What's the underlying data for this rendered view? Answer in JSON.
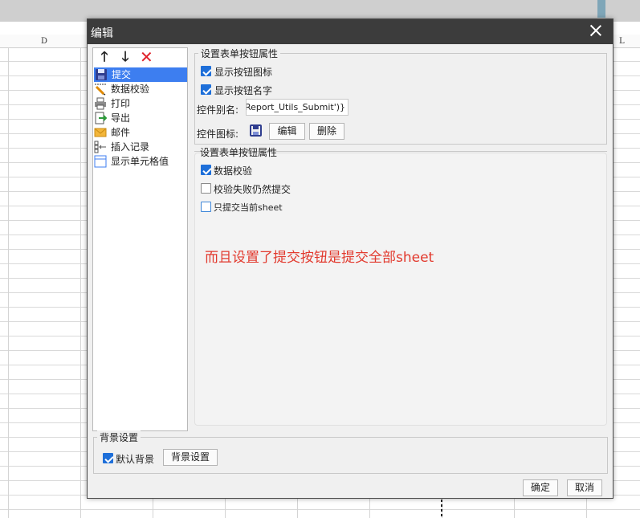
{
  "sheet": {
    "columns": [
      "D",
      "L"
    ]
  },
  "dialog": {
    "title": "编辑",
    "toolbar": {
      "up_icon": "arrow-up-icon",
      "down_icon": "arrow-down-icon",
      "delete_icon": "delete-x-icon"
    },
    "list_items": [
      {
        "label": "提交",
        "icon": "save-disk-icon",
        "selected": true
      },
      {
        "label": "数据校验",
        "icon": "pencil-check-icon"
      },
      {
        "label": "打印",
        "icon": "printer-icon"
      },
      {
        "label": "导出",
        "icon": "export-icon"
      },
      {
        "label": "邮件",
        "icon": "mail-envelope-icon"
      },
      {
        "label": "插入记录",
        "icon": "insert-row-icon"
      },
      {
        "label": "显示单元格值",
        "icon": "cell-value-icon"
      }
    ],
    "button_props": {
      "title": "设置表单按钮属性",
      "show_icon": {
        "label": "显示按钮图标",
        "checked": true
      },
      "show_name": {
        "label": "显示按钮名字",
        "checked": true
      },
      "alias_label": "控件别名:",
      "alias_value": "Report_Utils_Submit')}",
      "icon_label": "控件图标:",
      "edit_label": "编辑",
      "delete_label": "删除"
    },
    "submit_props": {
      "title": "设置表单按钮属性",
      "validate": {
        "label": "数据校验",
        "checked": true
      },
      "submit_on_fail": {
        "label": "校验失败仍然提交",
        "checked": false
      },
      "current_sheet_only": {
        "label": "只提交当前sheet",
        "checked": false
      }
    },
    "annotation": "而且设置了提交按钮是提交全部sheet",
    "background": {
      "title": "背景设置",
      "default_bg": {
        "label": "默认背景",
        "checked": true
      },
      "button_label": "背景设置"
    },
    "ok_label": "确定",
    "cancel_label": "取消",
    "colors": {
      "selection": "#3d7ef0",
      "annotation": "#e23a2e",
      "titlebar": "#3c3c3c",
      "checkbox": "#1e6fd9"
    }
  }
}
